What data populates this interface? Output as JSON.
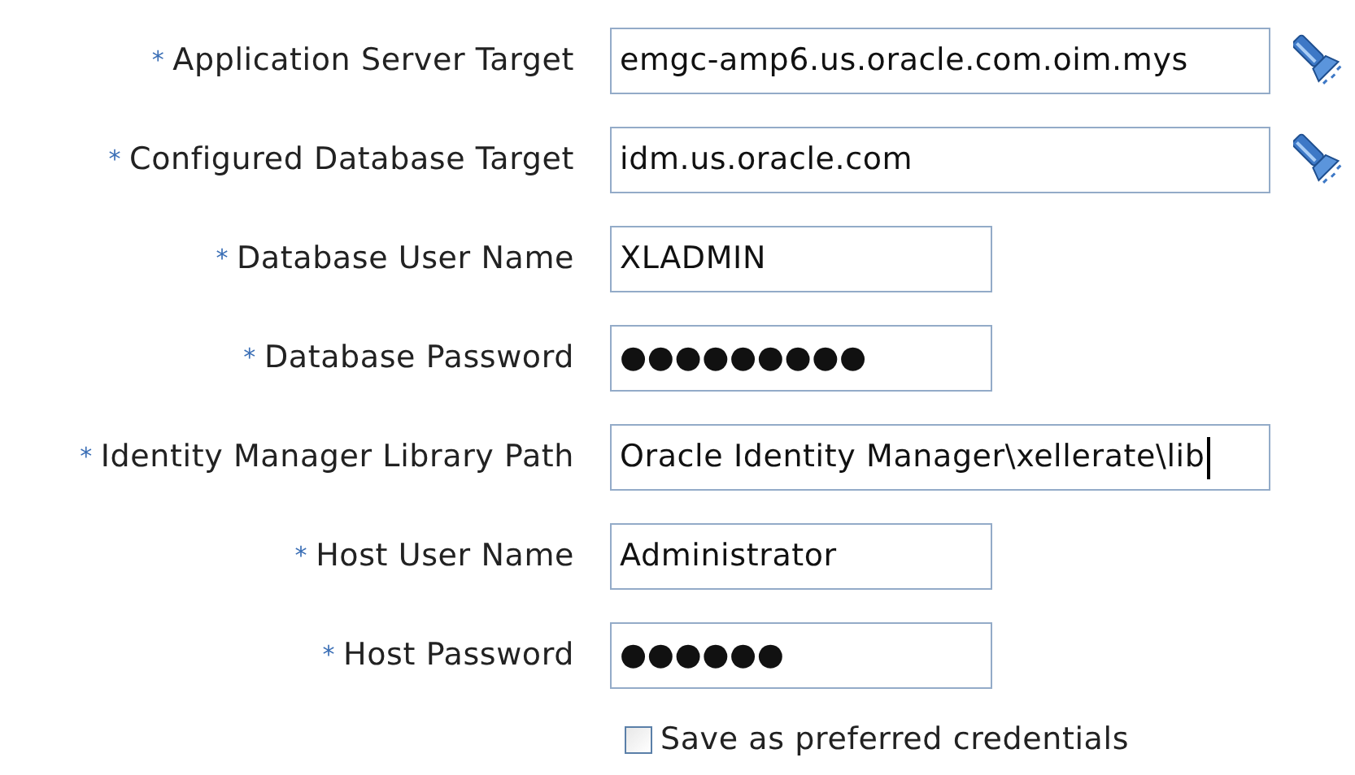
{
  "fields": [
    {
      "marker": "*",
      "label": "Application Server Target",
      "value": "emgc-amp6.us.oracle.com.oim.mys",
      "kind": "wide",
      "lookup": true,
      "focused": false
    },
    {
      "marker": "*",
      "label": "Configured Database Target",
      "value": "idm.us.oracle.com",
      "kind": "wide",
      "lookup": true,
      "focused": false
    },
    {
      "marker": "*",
      "label": "Database User Name",
      "value": "XLADMIN",
      "kind": "short",
      "lookup": false,
      "focused": false
    },
    {
      "marker": "*",
      "label": "Database Password",
      "value": "●●●●●●●●●",
      "kind": "short",
      "lookup": false,
      "focused": false
    },
    {
      "marker": "*",
      "label": "Identity Manager Library Path",
      "value": "Oracle Identity Manager\\xellerate\\lib",
      "kind": "wide",
      "lookup": false,
      "focused": true
    },
    {
      "marker": "*",
      "label": "Host User Name",
      "value": "Administrator",
      "kind": "short",
      "lookup": false,
      "focused": false
    },
    {
      "marker": "*",
      "label": "Host Password",
      "value": "●●●●●●",
      "kind": "short",
      "lookup": false,
      "focused": false
    }
  ],
  "save_preferred": {
    "label": "Save as preferred credentials",
    "checked": false
  }
}
